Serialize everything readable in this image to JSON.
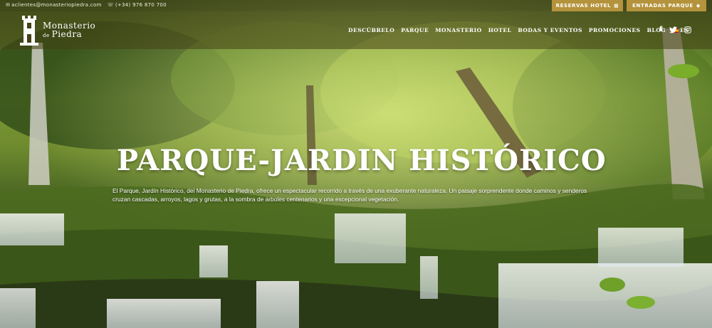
{
  "topbar": {
    "email": "aclientes@monasteriopiedra.com",
    "phone": "(+34) 976 870 700",
    "hotel_button": "RESERVAS HOTEL",
    "park_button": "ENTRADAS PARQUE"
  },
  "logo": {
    "line1": "Monasterio",
    "line2_small": "de",
    "line2": "Piedra"
  },
  "menu": {
    "items": [
      "DESCÚBRELO",
      "PARQUE",
      "MONASTERIO",
      "HOTEL",
      "BODAS Y EVENTOS",
      "PROMOCIONES",
      "BLOG"
    ],
    "language": "ES"
  },
  "social": {
    "facebook": "f",
    "twitter": "t",
    "instagram": "ig"
  },
  "hero": {
    "title": "PARQUE-JARDIN HISTÓRICO",
    "description": "El Parque, Jardín Histórico, del Monasterio de Piedra, ofrece un espectacular recorrido a través de una exuberante naturaleza. Un paisaje sorprendente donde caminos y senderos cruzan cascadas, arroyos, lagos y grutas, a la sombra de árboles centenarios y una excepcional vegetación."
  },
  "colors": {
    "button_gold": "#b4933c",
    "bar_overlay": "#46411a"
  }
}
